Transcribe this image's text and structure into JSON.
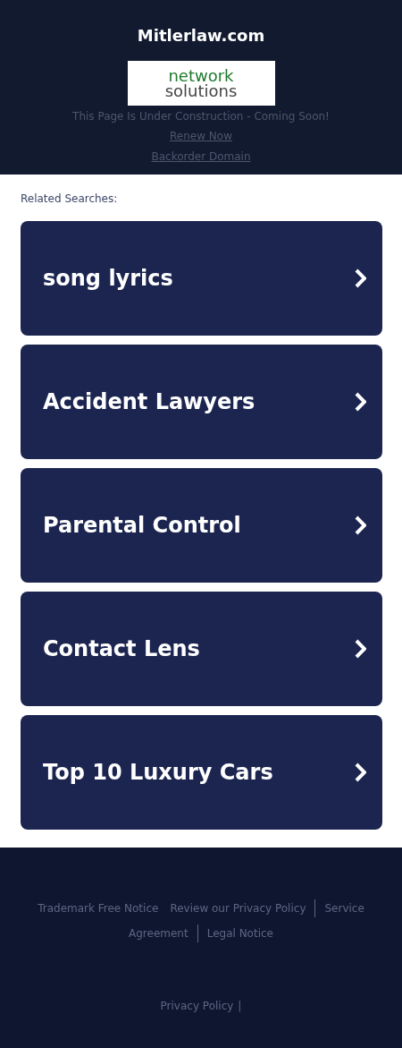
{
  "header": {
    "title": "Mitlerlaw.com",
    "logo": {
      "line_1": "network",
      "line_2": "solutions"
    },
    "notice": "This Page Is Under Construction - Coming Soon!",
    "links": [
      "Renew Now",
      "Backorder Domain"
    ]
  },
  "related": {
    "heading": "Related Searches:",
    "items": [
      "song lyrics",
      "Accident Lawyers",
      "Parental Control",
      "Contact Lens",
      "Top 10 Luxury Cars"
    ]
  },
  "footer": {
    "rows": [
      [
        {
          "label": "Trademark Free Notice",
          "divider": false
        },
        {
          "label": "Review our Privacy Policy",
          "divider": true
        },
        {
          "label": "Service",
          "divider": false
        }
      ],
      [
        {
          "label": "Agreement",
          "divider": true
        },
        {
          "label": "Legal Notice",
          "divider": false
        }
      ]
    ],
    "bottom_link": "Privacy Policy",
    "bottom_mark": "|"
  }
}
